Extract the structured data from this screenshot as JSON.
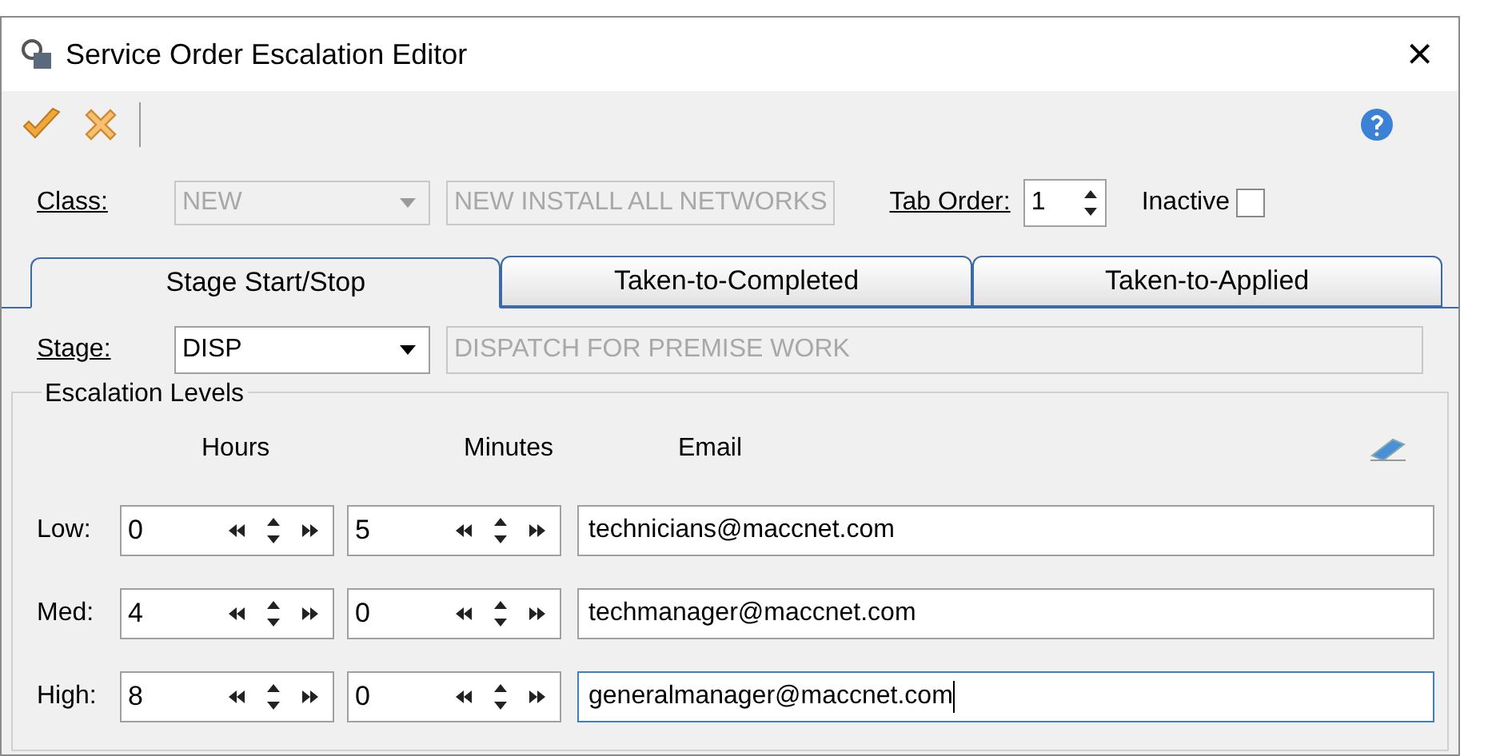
{
  "window": {
    "title": "Service Order Escalation Editor",
    "close": "×"
  },
  "class_row": {
    "label": "Class:",
    "class_value": "NEW",
    "description": "NEW INSTALL ALL NETWORKS",
    "disabled": true,
    "tab_order_label": "Tab Order:",
    "tab_order": "1",
    "inactive_label": "Inactive",
    "inactive_checked": false
  },
  "tabs": [
    {
      "label": "Stage Start/Stop",
      "selected": true
    },
    {
      "label": "Taken-to-Completed",
      "selected": false
    },
    {
      "label": "Taken-to-Applied",
      "selected": false
    }
  ],
  "stage_row": {
    "label": "Stage:",
    "value": "DISP",
    "description": "DISPATCH FOR PREMISE WORK"
  },
  "escalation_levels": {
    "title": "Escalation Levels",
    "columns": [
      "Hours",
      "Minutes",
      "Email"
    ],
    "rows": [
      {
        "label": "Low:",
        "hours": "0",
        "minutes": "5",
        "email": "technicians@maccnet.com",
        "focused": false
      },
      {
        "label": "Med:",
        "hours": "4",
        "minutes": "0",
        "email": "techmanager@maccnet.com",
        "focused": false
      },
      {
        "label": "High:",
        "hours": "8",
        "minutes": "0",
        "email": "generalmanager@maccnet.com",
        "focused": true
      }
    ]
  }
}
